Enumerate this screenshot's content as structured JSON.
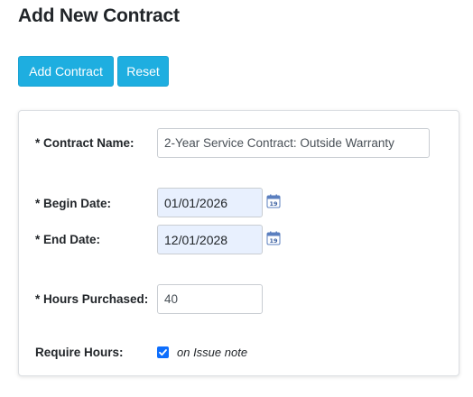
{
  "page": {
    "title": "Add New Contract"
  },
  "toolbar": {
    "add_label": "Add Contract",
    "reset_label": "Reset",
    "accent_color": "#1eaee0"
  },
  "form": {
    "contract_name": {
      "label": "* Contract Name:",
      "value": "2-Year Service Contract: Outside Warranty"
    },
    "begin_date": {
      "label": "* Begin Date:",
      "value": "01/01/2026",
      "icon": "calendar-icon",
      "icon_text": "19"
    },
    "end_date": {
      "label": "* End Date:",
      "value": "12/01/2028",
      "icon": "calendar-icon",
      "icon_text": "19"
    },
    "hours_purchased": {
      "label": "* Hours Purchased:",
      "value": "40"
    },
    "require_hours": {
      "label": "Require Hours:",
      "checked": true,
      "note": "on Issue note"
    }
  }
}
